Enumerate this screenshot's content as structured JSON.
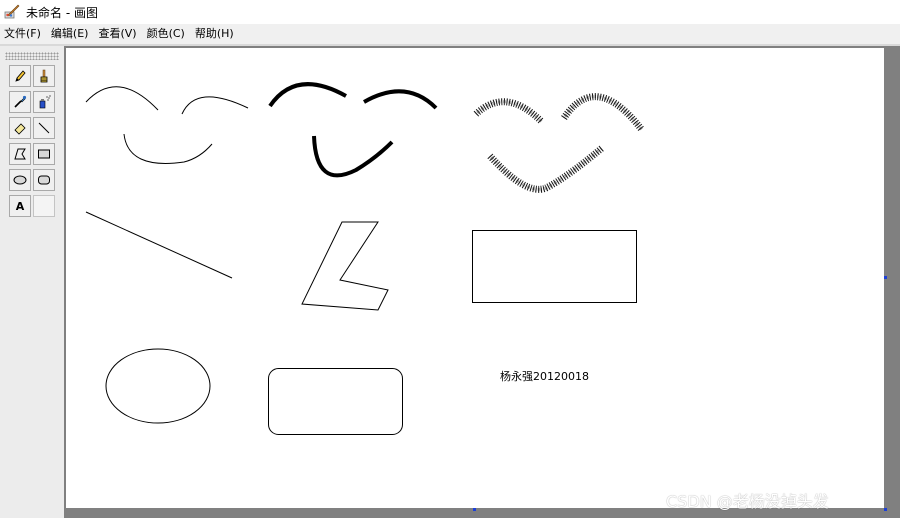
{
  "window": {
    "title": "未命名 - 画图"
  },
  "menu": [
    {
      "label": "文件(F)"
    },
    {
      "label": "编辑(E)"
    },
    {
      "label": "查看(V)"
    },
    {
      "label": "颜色(C)"
    },
    {
      "label": "帮助(H)"
    }
  ],
  "toolbox": {
    "tools": [
      {
        "name": "pencil-icon"
      },
      {
        "name": "brush-icon"
      },
      {
        "name": "eyedropper-icon"
      },
      {
        "name": "airbrush-icon"
      },
      {
        "name": "eraser-icon"
      },
      {
        "name": "line-icon"
      },
      {
        "name": "polygon-icon"
      },
      {
        "name": "rectangle-icon"
      },
      {
        "name": "ellipse-icon"
      },
      {
        "name": "rounded-rectangle-icon"
      },
      {
        "name": "text-icon"
      },
      {
        "name": "empty-slot"
      }
    ],
    "text_tool_glyph": "A"
  },
  "canvas": {
    "text": "杨永强20120018"
  },
  "watermark": "CSDN @老杨没掉头发",
  "colors": {
    "canvas": "#ffffff",
    "workspace": "#808080",
    "handle": "#1c3fd8"
  }
}
